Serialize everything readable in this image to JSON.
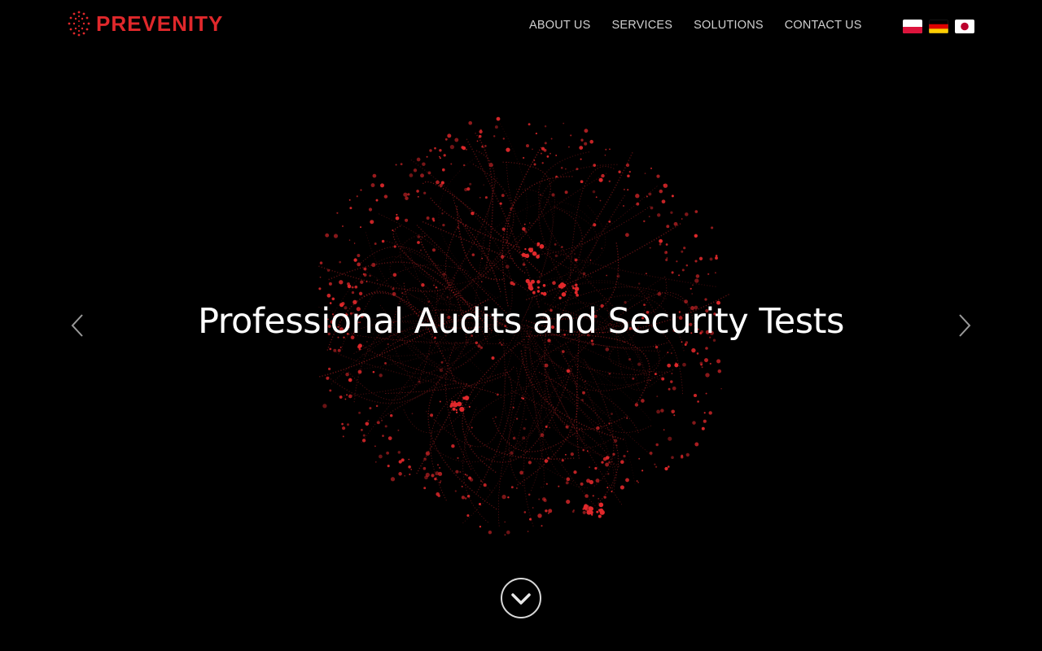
{
  "brand": {
    "name": "PREVENITY",
    "color": "#e0282b",
    "logo_icon": "dotted-circle-logo-icon"
  },
  "nav": {
    "items": [
      {
        "label": "ABOUT US"
      },
      {
        "label": "SERVICES"
      },
      {
        "label": "SOLUTIONS"
      },
      {
        "label": "CONTACT US"
      }
    ],
    "text_color": "#cfcfcf"
  },
  "languages": [
    {
      "name": "polish-flag-icon"
    },
    {
      "name": "german-flag-icon"
    },
    {
      "name": "japanese-flag-icon"
    }
  ],
  "hero": {
    "title": "Professional Audits and Security Tests",
    "background_color": "#000000",
    "particle_color": "#e0282b",
    "prev_icon": "chevron-left-icon",
    "next_icon": "chevron-right-icon",
    "scroll_icon": "chevron-down-circle-icon"
  }
}
